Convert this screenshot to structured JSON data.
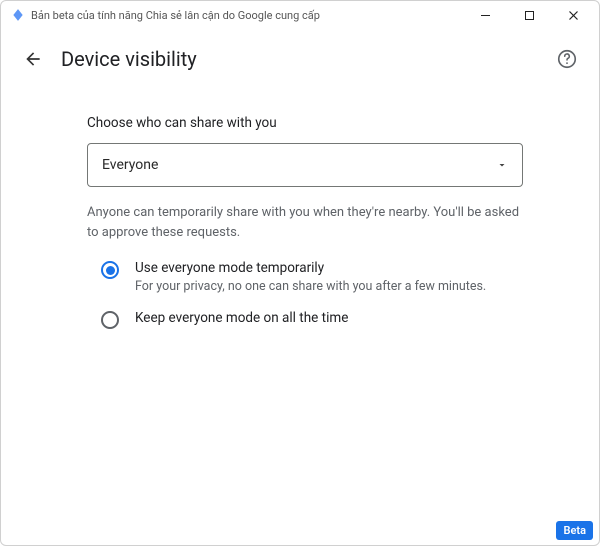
{
  "window": {
    "title": "Bản beta của tính năng Chia sẻ lân cận do Google cung cấp"
  },
  "header": {
    "title": "Device visibility"
  },
  "card": {
    "section_title": "Choose who can share with you",
    "select_value": "Everyone",
    "description": "Anyone can temporarily share with you when they're nearby. You'll be asked to approve these requests.",
    "radios": {
      "opt1": {
        "label": "Use everyone mode temporarily",
        "sub": "For your privacy, no one can share with you after a few minutes."
      },
      "opt2": {
        "label": "Keep everyone mode on all the time"
      }
    }
  },
  "badge": "Beta"
}
